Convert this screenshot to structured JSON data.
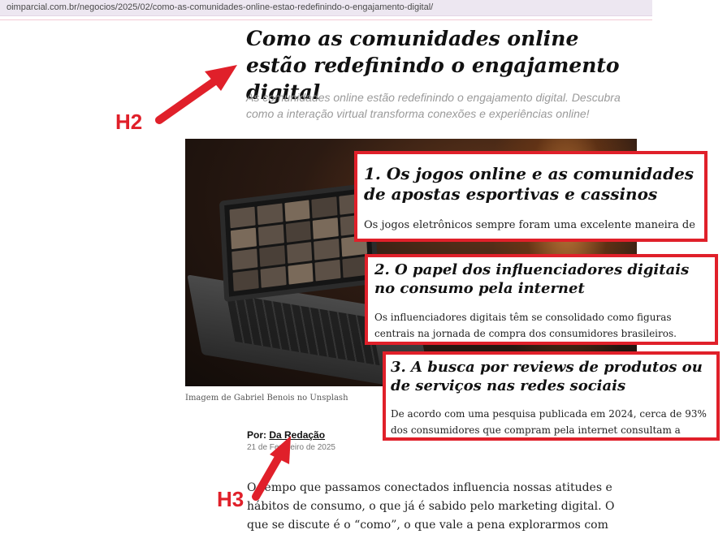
{
  "browser": {
    "url": "oimparcial.com.br/negocios/2025/02/como-as-comunidades-online-estao-redefinindo-o-engajamento-digital/"
  },
  "article": {
    "title": "Como as comunidades online estão redefinindo o engajamento digital",
    "subtitle": "As comunidades online estão redefinindo o engajamento digital. Descubra como a interação virtual transforma conexões e experiências online!",
    "photo_caption": "Imagem de Gabriel Benois no Unsplash",
    "byline_prefix": "Por:",
    "author": "Da Redação",
    "date": "21 de Fevereiro de 2025",
    "body_intro": "O tempo que passamos conectados influencia nossas atitudes e hábitos de consumo, o que já é sabido pelo marketing digital. O que se discute é o “como”, o que vale a pena explorarmos com profundidade."
  },
  "callouts": [
    {
      "heading": "1. Os jogos online e as comunidades de apostas esportivas e cassinos",
      "text": "Os jogos eletrônicos sempre foram uma excelente maneira de"
    },
    {
      "heading": "2. O papel dos influenciadores digitais no consumo pela internet",
      "text": "Os influenciadores digitais têm se consolidado como figuras centrais na jornada de compra dos consumidores brasileiros. Estudos recentes"
    },
    {
      "heading": "3. A busca por reviews de produtos ou de serviços nas redes sociais",
      "text": "De acordo com uma pesquisa publicada em 2024, cerca de 93% dos consumidores que compram pela internet consultam a opinião de"
    }
  ],
  "annotations": {
    "h2_label": "H2",
    "h3_label": "H3",
    "accent_color": "#e0202a"
  },
  "icons": [
    "arrow-h2-icon",
    "arrow-h3-icon"
  ]
}
